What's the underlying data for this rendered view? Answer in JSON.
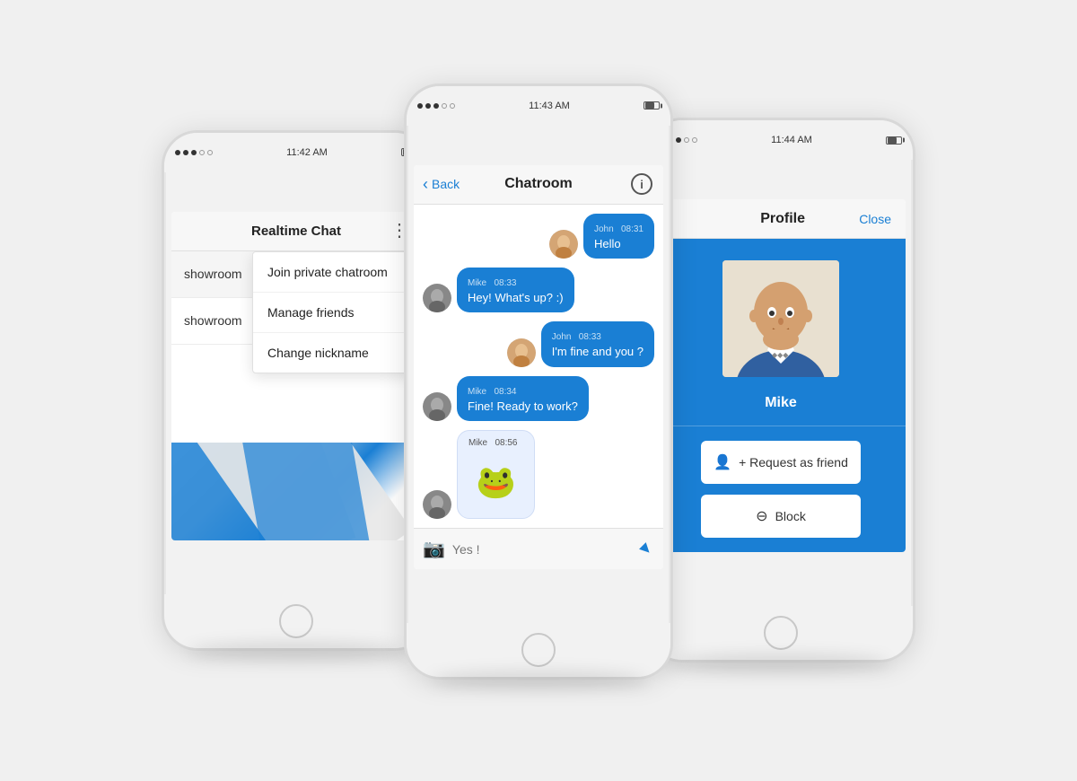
{
  "scene": {
    "phones": [
      {
        "id": "phone1",
        "status_bar": {
          "time": "11:42 AM",
          "signal": "●●●○○",
          "battery": "▓▓▓"
        },
        "app": {
          "header_title": "Realtime Chat",
          "more_icon": "⋮",
          "chat_items": [
            {
              "label": "showroom"
            },
            {
              "label": "showroom"
            }
          ],
          "dropdown": {
            "items": [
              "Join private chatroom",
              "Manage friends",
              "Change nickname"
            ]
          }
        }
      },
      {
        "id": "phone2",
        "status_bar": {
          "time": "11:43 AM"
        },
        "app": {
          "back_label": "Back",
          "title": "Chatroom",
          "messages": [
            {
              "sender": "John",
              "time": "08:31",
              "text": "Hello",
              "side": "right",
              "avatar": "john"
            },
            {
              "sender": "Mike",
              "time": "08:33",
              "text": "Hey! What's up? :)",
              "side": "left",
              "avatar": "mike"
            },
            {
              "sender": "John",
              "time": "08:33",
              "text": "I'm fine and you ?",
              "side": "right",
              "avatar": "john"
            },
            {
              "sender": "Mike",
              "time": "08:34",
              "text": "Fine! Ready to work?",
              "side": "left",
              "avatar": "mike"
            },
            {
              "sender": "Mike",
              "time": "08:56",
              "text": "",
              "side": "left",
              "avatar": "mike",
              "emoji": "🐸"
            }
          ],
          "input_placeholder": "Yes !",
          "camera_icon": "📷",
          "send_icon": "➤"
        }
      },
      {
        "id": "phone3",
        "status_bar": {
          "time": "11:44 AM"
        },
        "app": {
          "title": "Profile",
          "close_label": "Close",
          "user_name": "Mike",
          "actions": [
            {
              "icon": "👤",
              "label": "+ Request as friend"
            },
            {
              "icon": "⊖",
              "label": "Block"
            }
          ]
        }
      }
    ]
  }
}
